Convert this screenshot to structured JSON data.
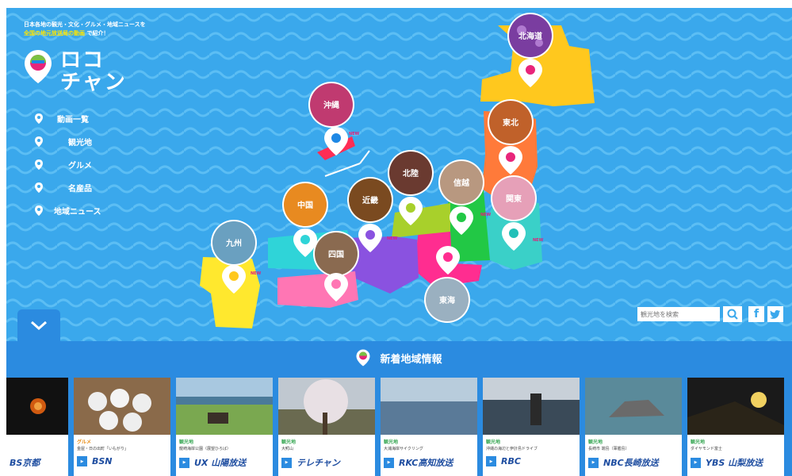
{
  "tagline": {
    "line1": "日本各地の観光・文化・グルメ・地域ニュースを",
    "line2_highlight": "全国の地元放送局の動画",
    "line2_rest": "で紹介！"
  },
  "logo": {
    "line1": "ロコ",
    "line2": "チャン"
  },
  "nav": [
    {
      "label": "動画一覧"
    },
    {
      "label": "観光地"
    },
    {
      "label": "グルメ"
    },
    {
      "label": "名産品"
    },
    {
      "label": "地域ニュース"
    }
  ],
  "regions": {
    "hokkaido": "北海道",
    "tohoku": "東北",
    "kanto": "関東",
    "shinetsu": "信越",
    "hokuriku": "北陸",
    "kinki": "近畿",
    "chugoku": "中国",
    "shikoku": "四国",
    "kyushu": "九州",
    "okinawa": "沖縄",
    "tokai": "東海"
  },
  "new_tag": "NEW",
  "search": {
    "placeholder": "観光地を検索"
  },
  "social": {
    "facebook": "f",
    "twitter": "t"
  },
  "news": {
    "title": "新着地域情報",
    "cards": [
      {
        "category": "",
        "caption": "",
        "broadcaster": "BS京都"
      },
      {
        "category": "グルメ",
        "caption": "金屋・日の出町「いもがり」",
        "broadcaster": "BSN"
      },
      {
        "category": "観光地",
        "caption": "龍崎海岸公園（展望ひろば）",
        "broadcaster": "UX 山陽放送"
      },
      {
        "category": "観光地",
        "caption": "大鰐山",
        "broadcaster": "テレチャン"
      },
      {
        "category": "観光地",
        "caption": "大浦海岸サイクリング",
        "broadcaster": "RKC高知放送"
      },
      {
        "category": "観光地",
        "caption": "沖縄の海辺と伊計島ドライブ",
        "broadcaster": "RBC"
      },
      {
        "category": "観光地",
        "caption": "長崎市 端島（軍艦島）",
        "broadcaster": "NBC長崎放送"
      },
      {
        "category": "観光地",
        "caption": "ダイヤモンド富士",
        "broadcaster": "YBS 山梨放送"
      }
    ]
  },
  "colors": {
    "sea": "#3aa8ec",
    "band": "#2b8be0",
    "pin_red": "#e8257a",
    "pin_green": "#7ac143",
    "pin_blue": "#1e88e5"
  }
}
